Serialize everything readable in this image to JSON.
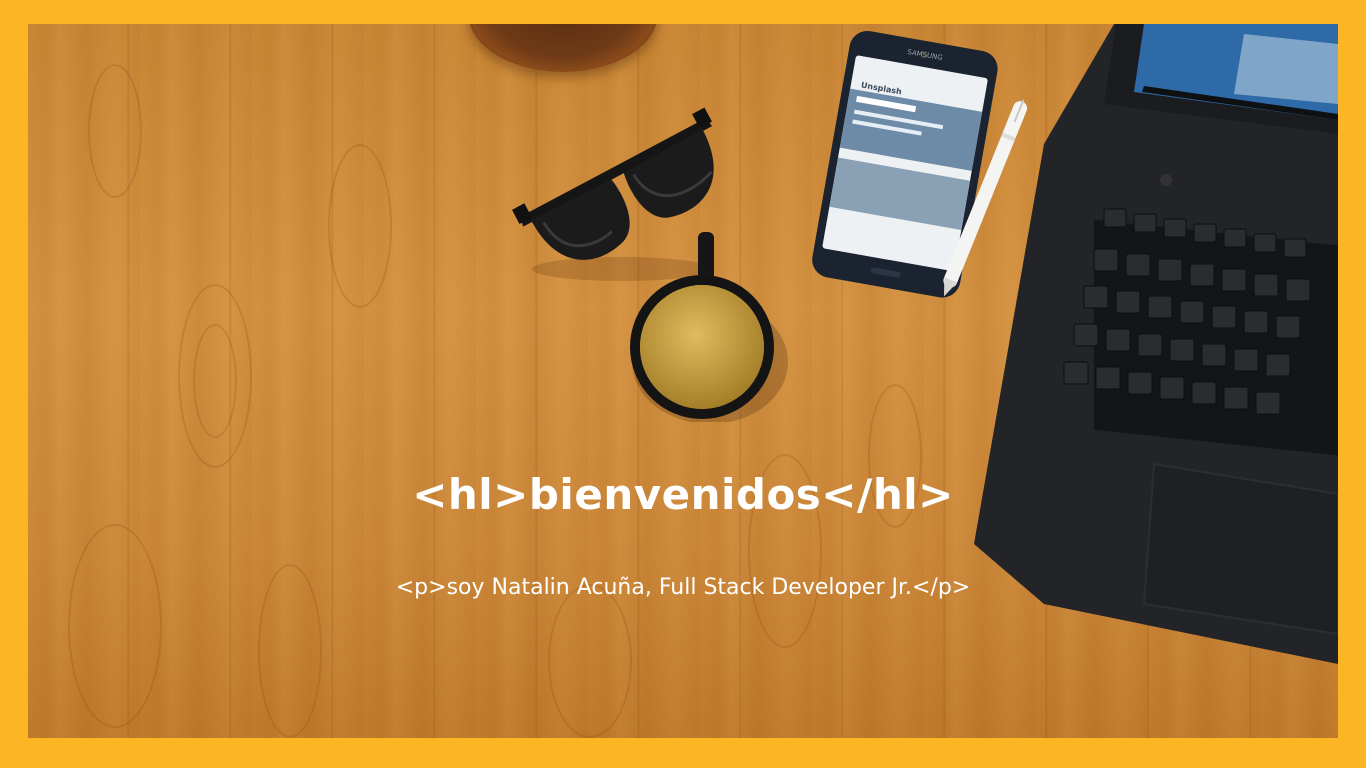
{
  "colors": {
    "frame": "#FDB623",
    "wood": "#D49141",
    "text": "#FFFFFF"
  },
  "hero": {
    "heading": "<hl>bienvenidos</hl>",
    "tagline": "<p>soy Natalin Acuña, Full Stack Developer Jr.</p>"
  },
  "phone": {
    "brand": "SAMSUNG",
    "app_title": "Unsplash"
  },
  "icons": {
    "sunglasses": "sunglasses-icon",
    "coffee": "coffee-cup-icon",
    "phone": "smartphone-icon",
    "pen": "pen-icon",
    "laptop": "laptop-icon"
  }
}
